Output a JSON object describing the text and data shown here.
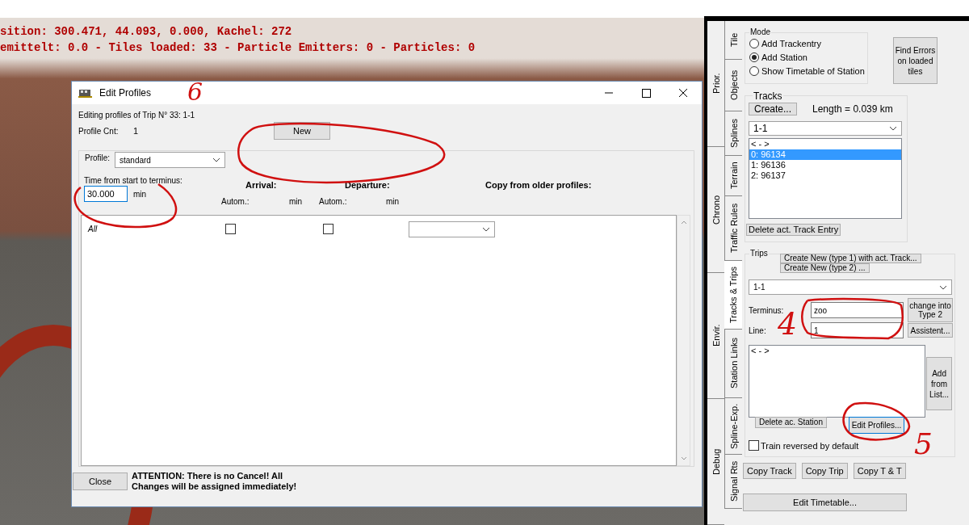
{
  "hud": {
    "lines": [
      "sition: 300.471, 44.093, 0.000, Kachel: 272",
      "emittelt: 0.0 - Tiles loaded: 33 - Particle Emitters: 0 - Particles: 0"
    ]
  },
  "dialog": {
    "title": "Edit Profiles",
    "trip_line": "Editing profiles of Trip N° 33: 1-1",
    "profile_count_label": "Profile Cnt:",
    "profile_count": "1",
    "new_button": "New",
    "profile_label": "Profile:",
    "profile_value": "standard",
    "time_label": "Time from start to terminus:",
    "time_value": "30.000",
    "time_unit": "min",
    "headers": [
      "Arrival:",
      "Departure:",
      "Copy from older profiles:"
    ],
    "subheaders": [
      "Autom.:",
      "min",
      "Autom.:",
      "min"
    ],
    "rows": [
      {
        "label": "All",
        "arrival_auto": false,
        "departure_auto": false
      }
    ],
    "close_button": "Close",
    "attention": "ATTENTION: There is no Cancel! All Changes will be assigned immediately!"
  },
  "panel": {
    "outer_tabs": [
      {
        "label": "Prior."
      },
      {
        "label": "Chrono"
      },
      {
        "label": "Envir."
      },
      {
        "label": "Debug"
      }
    ],
    "inner_tabs": [
      {
        "label": "Tile",
        "selected": false
      },
      {
        "label": "Objects",
        "selected": false
      },
      {
        "label": "Splines",
        "selected": false
      },
      {
        "label": "Terrain",
        "selected": false
      },
      {
        "label": "Traffic Rules",
        "selected": false
      },
      {
        "label": "Tracks & Trips",
        "selected": true
      },
      {
        "label": "Station Links",
        "selected": false
      },
      {
        "label": "Spline-Exp.",
        "selected": false
      },
      {
        "label": "Signal Rts",
        "selected": false
      }
    ],
    "mode": {
      "title": "Mode",
      "options": [
        {
          "label": "Add Trackentry",
          "selected": false
        },
        {
          "label": "Add Station",
          "selected": true
        },
        {
          "label": "Show Timetable of Station",
          "selected": false
        }
      ]
    },
    "find_errors_button": "Find Errors on loaded tiles",
    "tracks": {
      "title": "Tracks",
      "create_button": "Create...",
      "length": "Length = 0.039 km",
      "combo": "1-1",
      "items": [
        {
          "label": "< - >",
          "selected": false
        },
        {
          "label": "0: 96134",
          "selected": true
        },
        {
          "label": "1: 96136",
          "selected": false
        },
        {
          "label": "2: 96137",
          "selected": false
        }
      ],
      "delete_button": "Delete act. Track Entry"
    },
    "trips": {
      "title": "Trips",
      "create_buttons": [
        "Create New  (type 1) with act. Track...",
        "Create New  (type 2) ..."
      ],
      "combo": "1-1",
      "terminus_label": "Terminus:",
      "terminus_value": "zoo",
      "line_label": "Line:",
      "line_value": "1",
      "change_button": "change into Type 2",
      "assistent_button": "Assistent...",
      "stations": [
        "< - >"
      ],
      "add_button": "Add from List...",
      "delete_button": "Delete ac. Station",
      "edit_profiles_button": "Edit Profiles...",
      "reversed_label": "Train reversed by default",
      "reversed": false
    },
    "buttons": [
      "Copy Track",
      "Copy Trip",
      "Copy T & T"
    ],
    "edit_timetable": "Edit Timetable..."
  },
  "annotations": [
    {
      "number": "6"
    },
    {
      "number": "4"
    },
    {
      "number": "5"
    }
  ]
}
